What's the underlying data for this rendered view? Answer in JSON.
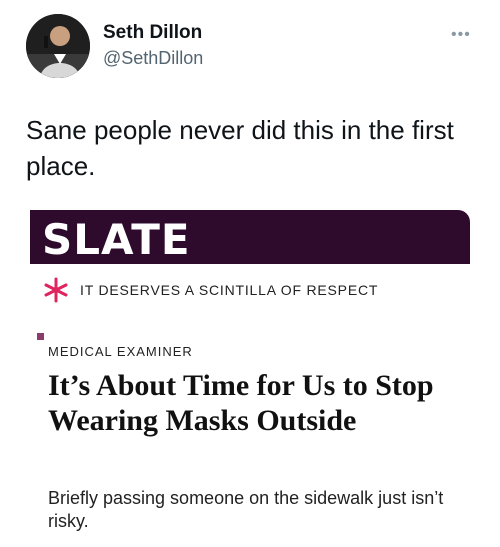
{
  "tweet": {
    "author_name": "Seth Dillon",
    "author_handle": "@SethDillon",
    "more_icon": "more-horizontal-icon",
    "more_glyph": "•••",
    "text": "Sane people never did this in the first place."
  },
  "card": {
    "publication": "SLATE",
    "tagline": "IT DESERVES A SCINTILLA OF RESPECT",
    "section": "MEDICAL EXAMINER",
    "headline": "It’s About Time for Us to Stop Wearing Masks Outside",
    "dek": "Briefly passing someone on the sidewalk just isn’t risky.",
    "colors": {
      "brand_bar": "#2e0b2c",
      "accent": "#e0245e",
      "section_mark": "#8a3d6a"
    }
  }
}
